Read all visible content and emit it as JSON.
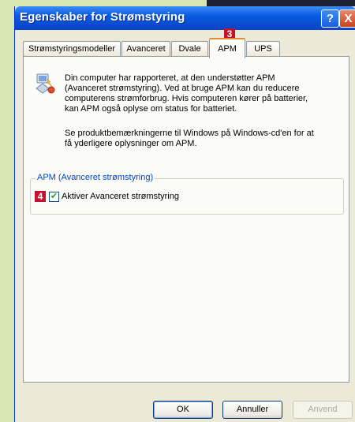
{
  "window": {
    "title": "Egenskaber for Strømstyring",
    "help_glyph": "?",
    "close_glyph": "X"
  },
  "tabs": [
    {
      "label": "Strømstyringsmodeller"
    },
    {
      "label": "Avanceret"
    },
    {
      "label": "Dvale"
    },
    {
      "label": "APM",
      "active": true
    },
    {
      "label": "UPS"
    }
  ],
  "badges": {
    "tab_marker": "3",
    "checkbox_marker": "4"
  },
  "panel": {
    "icon": "power-management-icon",
    "paragraph1": [
      "Din computer har rapporteret, at den understøtter APM",
      "(Avanceret strømstyring). Ved at bruge APM kan du reducere",
      "computerens strømforbrug. Hvis computeren kører på batterier,",
      "kan APM også oplyse om status for batteriet."
    ],
    "paragraph2": [
      "Se produktbemærkningerne til Windows på Windows-cd'en for at",
      "få yderligere oplysninger om APM."
    ],
    "group_label": "APM (Avanceret strømstyring)",
    "checkbox_label": "Aktiver Avanceret strømstyring",
    "checkbox_checked": true
  },
  "buttons": {
    "ok": "OK",
    "cancel": "Annuller",
    "apply": "Anvend"
  },
  "colors": {
    "accent": "#c8102e",
    "titlebar": "#0a5ae3",
    "background": "#d7e7b4"
  }
}
